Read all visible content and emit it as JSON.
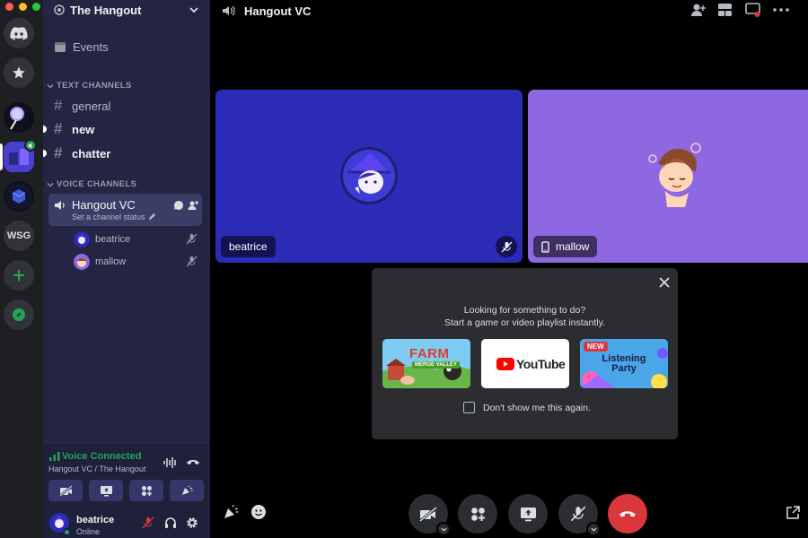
{
  "server": {
    "name": "The Hangout"
  },
  "rail": {
    "wsg_label": "WSG"
  },
  "sidebar": {
    "events_label": "Events",
    "text_category": "TEXT CHANNELS",
    "text_channels": [
      "general",
      "new",
      "chatter"
    ],
    "voice_category": "VOICE CHANNELS",
    "voice_channel": {
      "name": "Hangout VC",
      "status_placeholder": "Set a channel status"
    },
    "members": [
      "beatrice",
      "mallow"
    ]
  },
  "voice_panel": {
    "status": "Voice Connected",
    "location": "Hangout VC / The Hangout"
  },
  "user": {
    "name": "beatrice",
    "status": "Online"
  },
  "call": {
    "title": "Hangout VC",
    "tiles": [
      {
        "name": "beatrice",
        "bg": "#2b2bb8"
      },
      {
        "name": "mallow",
        "bg": "#8d68e0"
      }
    ]
  },
  "activity_popup": {
    "line1": "Looking for something to do?",
    "line2": "Start a game or video playlist instantly.",
    "cards": [
      {
        "title": "FARM",
        "subtitle": "MERGE VALLEY",
        "badge": ""
      },
      {
        "title": "YouTube",
        "subtitle": "",
        "badge": ""
      },
      {
        "title": "Listening Party",
        "subtitle": "",
        "badge": "NEW"
      }
    ],
    "checkbox_label": "Don't show me this again."
  },
  "colors": {
    "accent": "#5865f2",
    "green": "#23a559",
    "danger": "#da373c",
    "sidebar_bg": "#242543"
  }
}
